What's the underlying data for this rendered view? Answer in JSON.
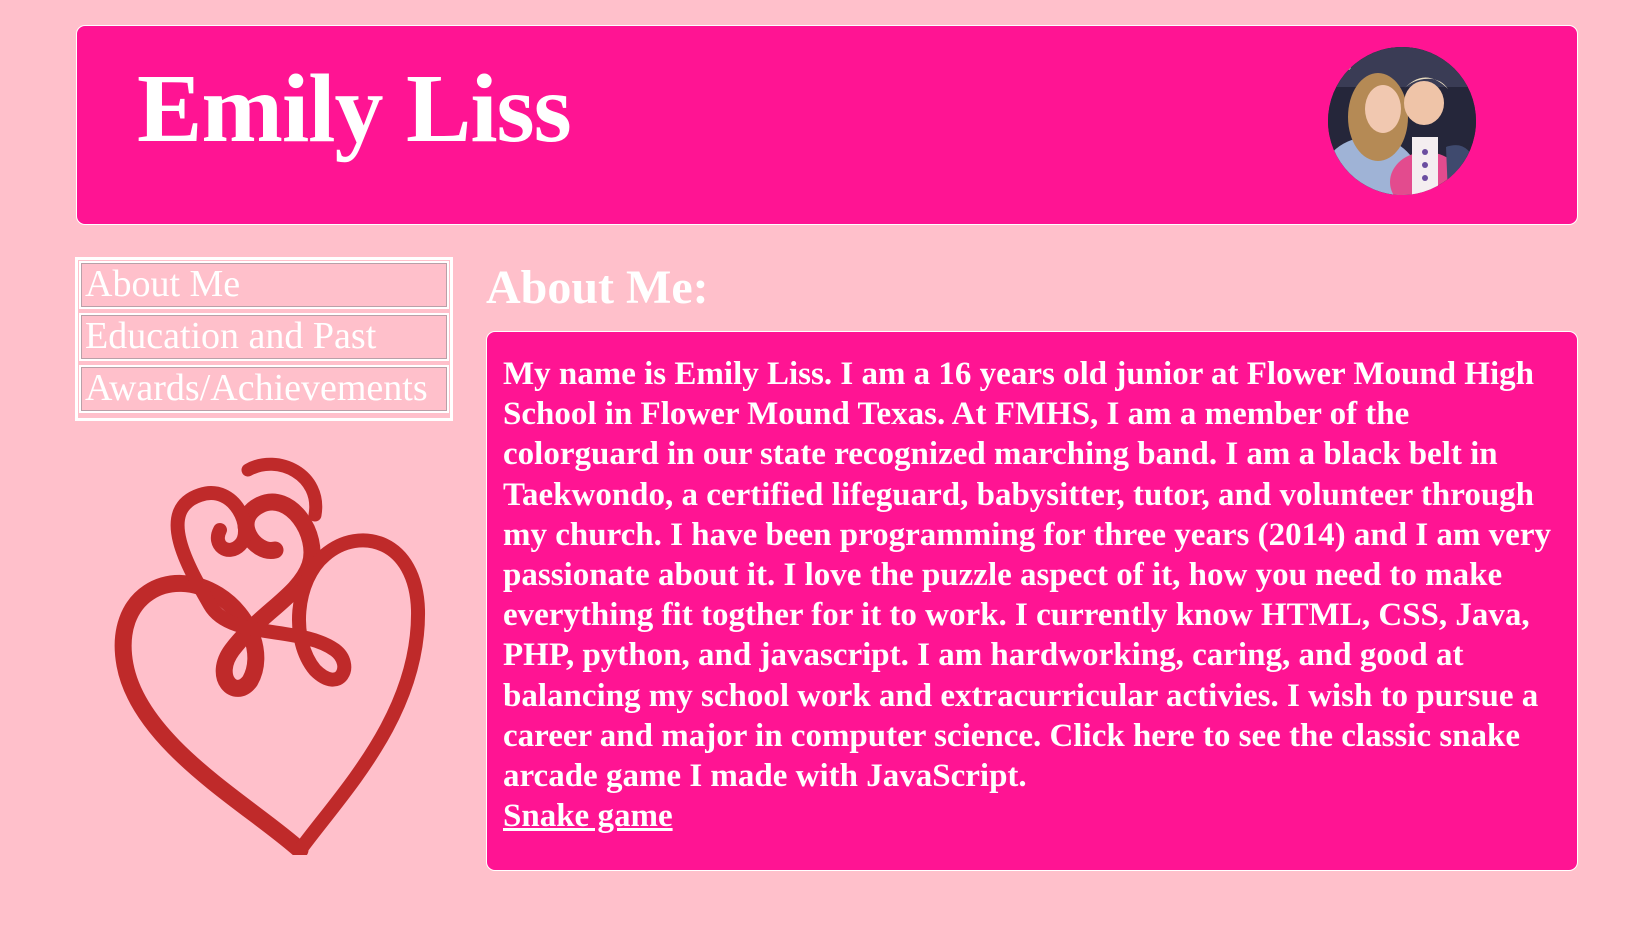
{
  "header": {
    "title": "Emily Liss"
  },
  "nav": {
    "items": [
      {
        "label": "About Me"
      },
      {
        "label": "Education and Past"
      },
      {
        "label": "Awards/Achievements"
      }
    ]
  },
  "main": {
    "section_title": "About Me:",
    "body_text": "My name is Emily Liss. I am a 16 years old junior at Flower Mound High School in Flower Mound Texas. At FMHS, I am a member of the colorguard in our state recognized marching band. I am a black belt in Taekwondo, a certified lifeguard, babysitter, tutor, and volunteer through my church. I have been programming for three years (2014) and I am very passionate about it. I love the puzzle aspect of it, how you need to make everything fit togther for it to work. I currently know HTML, CSS, Java, PHP, python, and javascript. I am hardworking, caring, and good at balancing my school work and extracurricular activies. I wish to pursue a career and major in computer science. Click here to see the classic snake arcade game I made with JavaScript.",
    "link_label": "Snake game"
  },
  "colors": {
    "page_background": "#ffc0cb",
    "accent": "#ff1493",
    "text": "#ffffff",
    "heart": "#bf2a2a"
  },
  "icons": {
    "profile_photo": "avatar-photo",
    "decoration": "heart-icon"
  }
}
